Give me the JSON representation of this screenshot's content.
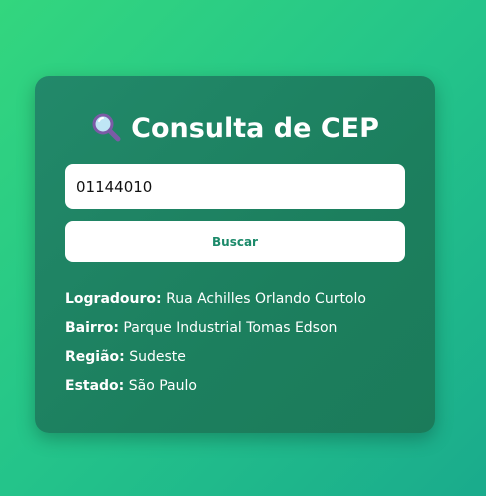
{
  "title": "Consulta de CEP",
  "title_icon": "magnifying-glass-icon",
  "cep_input": {
    "value": "01144010"
  },
  "search_button": {
    "label": "Buscar"
  },
  "result": {
    "logradouro": {
      "label": "Logradouro:",
      "value": "Rua Achilles Orlando Curtolo"
    },
    "bairro": {
      "label": "Bairro:",
      "value": "Parque Industrial Tomas Edson"
    },
    "regiao": {
      "label": "Região:",
      "value": "Sudeste"
    },
    "estado": {
      "label": "Estado:",
      "value": "São Paulo"
    }
  },
  "colors": {
    "background_start": "#33d67e",
    "background_end": "#1aab8c",
    "card": "#1c7f5e",
    "button_text": "#1c8a6a"
  }
}
